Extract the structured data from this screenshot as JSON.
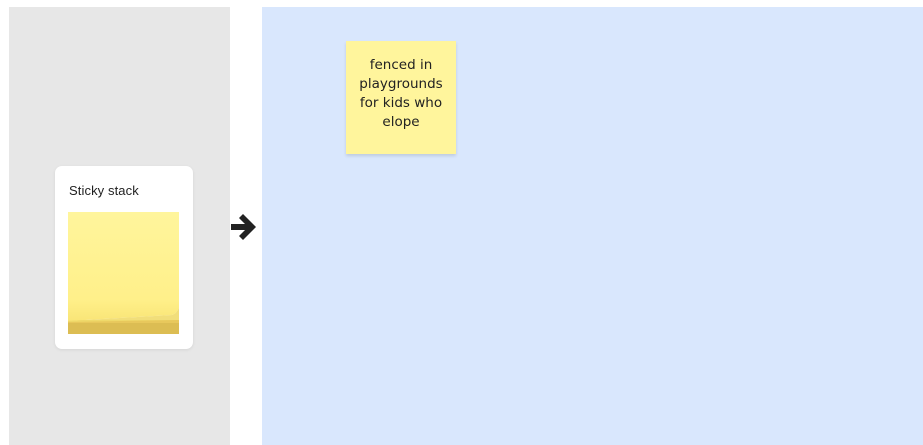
{
  "stack_card": {
    "title": "Sticky stack",
    "pad_color": "#fff59c",
    "pad_edge_color": "#dcbd53"
  },
  "board": {
    "background": "#d9e7fd",
    "sticky_note": {
      "text": "fenced in\nplaygrounds\nfor kids who\nelope",
      "color": "#fff59c"
    }
  },
  "icons": {
    "arrow": "arrow-right-icon"
  }
}
